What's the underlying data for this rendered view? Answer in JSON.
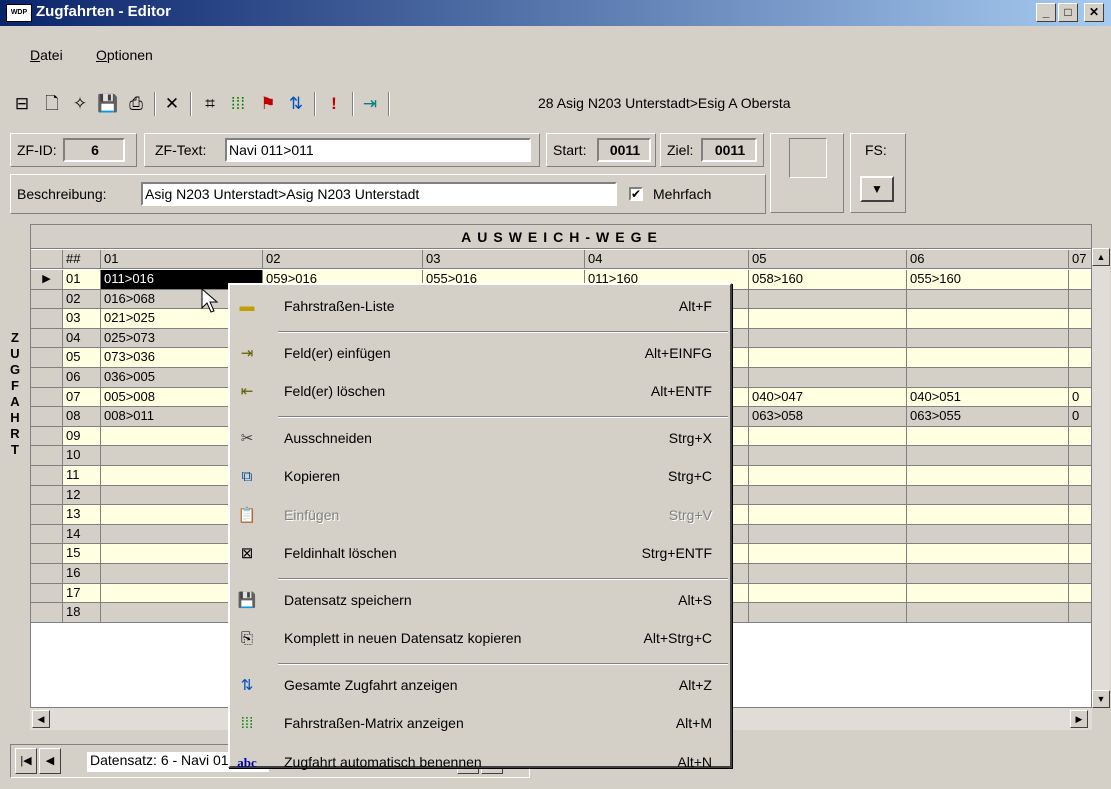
{
  "window": {
    "title": "Zugfahrten - Editor",
    "app_icon": "WDP"
  },
  "menu": [
    {
      "label": "Datei",
      "key": "D"
    },
    {
      "label": "Optionen",
      "key": "O"
    }
  ],
  "toolbar": {
    "status_text": "28 Asig N203 Unterstadt>Esig A Obersta"
  },
  "fields": {
    "zf_id_label": "ZF-ID:",
    "zf_id_value": "6",
    "zf_text_label": "ZF-Text:",
    "zf_text_value": "Navi 011>011",
    "start_label": "Start:",
    "start_value": "0011",
    "ziel_label": "Ziel:",
    "ziel_value": "0011",
    "fs_label": "FS:",
    "beschreibung_label": "Beschreibung:",
    "beschreibung_value": "Asig N203 Unterstadt>Asig N203 Unterstadt",
    "mehrfach_label": "Mehrfach",
    "mehrfach_checked": "✔"
  },
  "grid": {
    "caption": "AUSWEICH-WEGE",
    "side_label": [
      "Z",
      "U",
      "G",
      "F",
      "A",
      "H",
      "R",
      "T"
    ],
    "columns": [
      "##",
      "01",
      "02",
      "03",
      "04",
      "05",
      "06",
      "07"
    ],
    "rows": [
      {
        "n": "01",
        "c01": "011>016",
        "c02": "059>016",
        "c03": "055>016",
        "c04": "011>160",
        "c05": "058>160",
        "c06": "055>160",
        "c07": ""
      },
      {
        "n": "02",
        "c01": "016>068",
        "c02": "",
        "c03": "",
        "c04": "",
        "c05": "",
        "c06": "",
        "c07": ""
      },
      {
        "n": "03",
        "c01": "021>025",
        "c02": "",
        "c03": "",
        "c04": "",
        "c05": "",
        "c06": "",
        "c07": ""
      },
      {
        "n": "04",
        "c01": "025>073",
        "c02": "",
        "c03": "",
        "c04": "",
        "c05": "",
        "c06": "",
        "c07": ""
      },
      {
        "n": "05",
        "c01": "073>036",
        "c02": "",
        "c03": "",
        "c04": "",
        "c05": "",
        "c06": "",
        "c07": ""
      },
      {
        "n": "06",
        "c01": "036>005",
        "c02": "",
        "c03": "",
        "c04": "",
        "c05": "",
        "c06": "",
        "c07": ""
      },
      {
        "n": "07",
        "c01": "005>008",
        "c02": "",
        "c03": "",
        "c04": "",
        "c05": "040>047",
        "c06": "040>051",
        "c07": "0"
      },
      {
        "n": "08",
        "c01": "008>011",
        "c02": "",
        "c03": "",
        "c04": "",
        "c05": "063>058",
        "c06": "063>055",
        "c07": "0"
      },
      {
        "n": "09"
      },
      {
        "n": "10"
      },
      {
        "n": "11"
      },
      {
        "n": "12"
      },
      {
        "n": "13"
      },
      {
        "n": "14"
      },
      {
        "n": "15"
      },
      {
        "n": "16"
      },
      {
        "n": "17"
      },
      {
        "n": "18"
      }
    ]
  },
  "record_nav": {
    "label": "Datensatz: 6 - Navi 011>011"
  },
  "context_menu": [
    {
      "label": "Fahrstraßen-Liste",
      "shortcut": "Alt+F",
      "icon": "route-list-icon"
    },
    {
      "sep": true
    },
    {
      "label": "Feld(er) einfügen",
      "shortcut": "Alt+EINFG",
      "icon": "insert-field-icon"
    },
    {
      "label": "Feld(er) löschen",
      "shortcut": "Alt+ENTF",
      "icon": "delete-field-icon"
    },
    {
      "sep": true
    },
    {
      "label": "Ausschneiden",
      "shortcut": "Strg+X",
      "icon": "scissors-icon"
    },
    {
      "label": "Kopieren",
      "shortcut": "Strg+C",
      "icon": "copy-icon"
    },
    {
      "label": "Einfügen",
      "shortcut": "Strg+V",
      "icon": "paste-icon",
      "disabled": true
    },
    {
      "label": "Feldinhalt löschen",
      "shortcut": "Strg+ENTF",
      "icon": "clear-field-icon"
    },
    {
      "sep": true
    },
    {
      "label": "Datensatz speichern",
      "shortcut": "Alt+S",
      "icon": "save-icon"
    },
    {
      "label": "Komplett in neuen Datensatz kopieren",
      "shortcut": "Alt+Strg+C",
      "icon": "copy-record-icon"
    },
    {
      "sep": true
    },
    {
      "label": "Gesamte Zugfahrt anzeigen",
      "shortcut": "Alt+Z",
      "icon": "show-train-run-icon"
    },
    {
      "label": "Fahrstraßen-Matrix anzeigen",
      "shortcut": "Alt+M",
      "icon": "matrix-icon"
    },
    {
      "label": "Zugfahrt automatisch benennen",
      "shortcut": "Alt+N",
      "icon": "auto-name-icon"
    }
  ]
}
